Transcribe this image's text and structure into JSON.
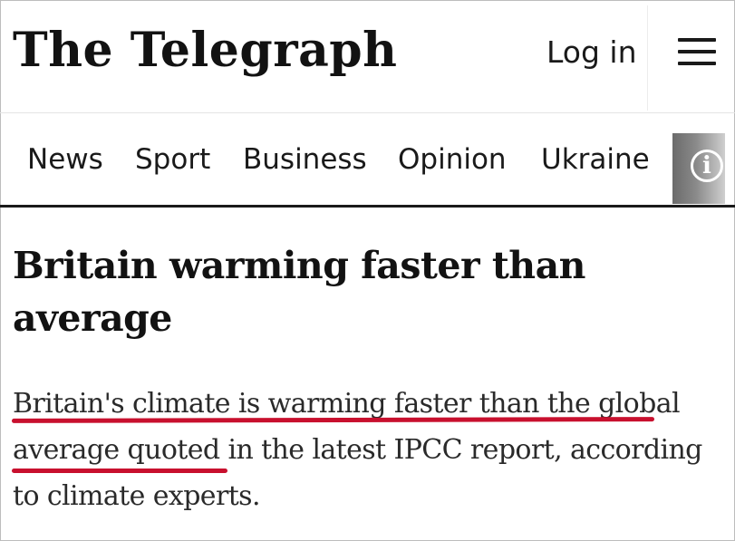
{
  "header": {
    "logo_text": "The Telegraph",
    "login_label": "Log in",
    "menu_icon": "hamburger-icon"
  },
  "nav": {
    "items": [
      {
        "label": "News"
      },
      {
        "label": "Sport"
      },
      {
        "label": "Business"
      },
      {
        "label": "Opinion"
      },
      {
        "label": "Ukraine"
      }
    ],
    "scroll_icon": "info-icon"
  },
  "article": {
    "headline": "Britain warming faster than average",
    "standfirst": "Britain's climate is warming faster than the global average quoted in the latest IPCC report, according to climate experts."
  },
  "colors": {
    "highlight_underline": "#c8102e",
    "text": "#1a1a1a",
    "background": "#ffffff"
  }
}
